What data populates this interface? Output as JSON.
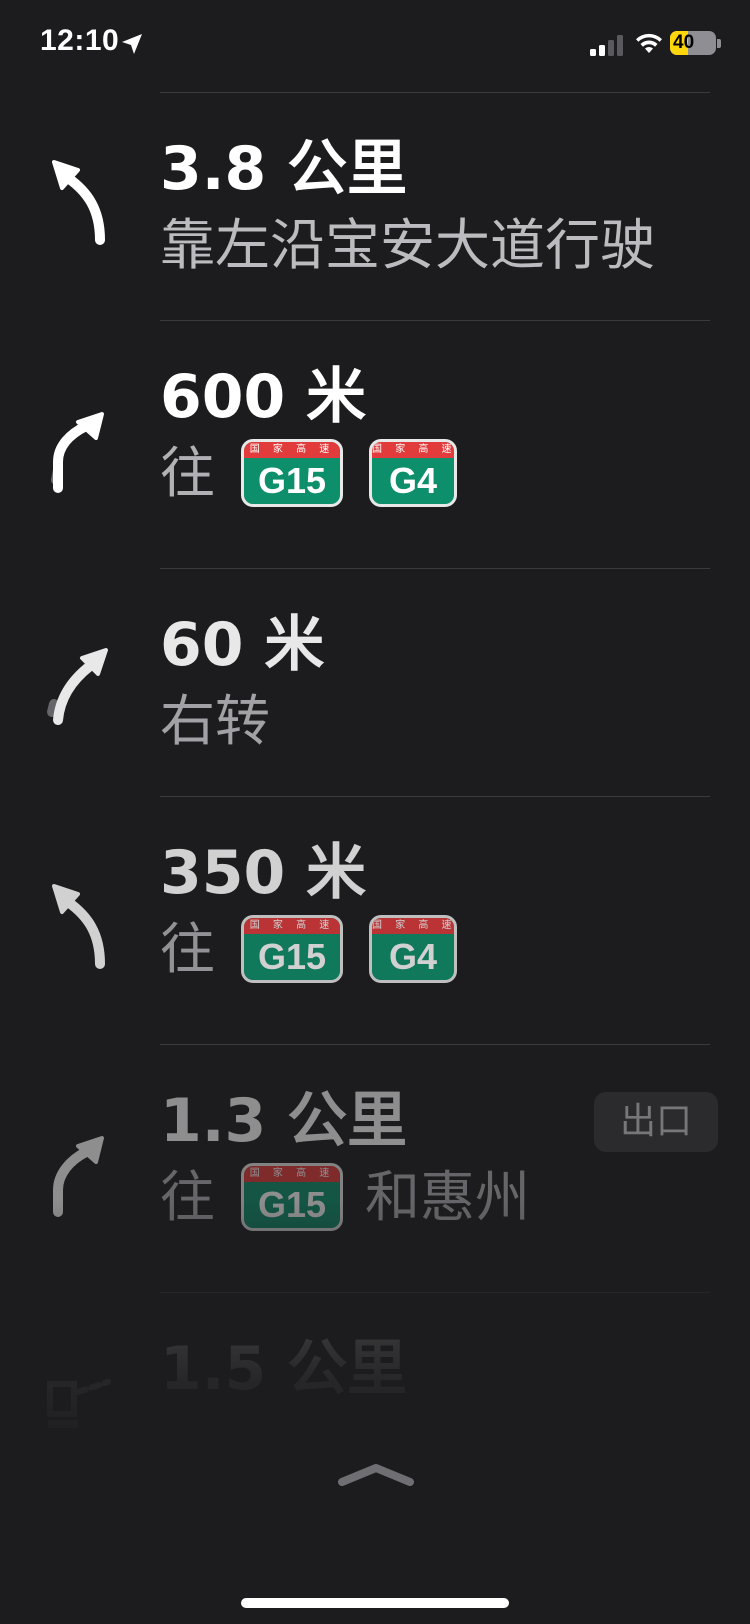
{
  "status_bar": {
    "time": "12:10",
    "battery_level": "40",
    "battery_fraction": 0.4,
    "signal_bars_active": 2,
    "signal_bars_total": 4,
    "icons": [
      "location-arrow-icon",
      "cellular-signal-icon",
      "wifi-icon",
      "battery-charging-icon"
    ]
  },
  "shield_header": "国 家 高 速",
  "steps": [
    {
      "distance": "3.8 公里",
      "instruction": "靠左沿宝安大道行驶",
      "icon": "keep-left-arrow-icon",
      "opacity": 1.0
    },
    {
      "distance": "600 米",
      "instruction_prefix": "往",
      "shields": [
        "G15",
        "G4"
      ],
      "icon": "bear-right-arrow-icon",
      "opacity": 1.0
    },
    {
      "distance": "60 米",
      "instruction": "右转",
      "icon": "turn-right-arrow-icon",
      "opacity": 0.9
    },
    {
      "distance": "350 米",
      "instruction_prefix": "往",
      "shields": [
        "G15",
        "G4"
      ],
      "icon": "keep-left-arrow-icon",
      "opacity": 0.8
    },
    {
      "distance": "1.3 公里",
      "instruction_prefix": "往",
      "shields": [
        "G15"
      ],
      "instruction_suffix": "和惠州",
      "exit_label": "出口",
      "icon": "bear-right-arrow-icon",
      "opacity": 0.5
    },
    {
      "distance": "1.5 公里",
      "icon": "toll-gate-icon",
      "opacity": 0.3
    }
  ],
  "colors": {
    "background": "#1c1c1e",
    "divider": "#3a3a3c",
    "shield_green": "#0e8f6b",
    "shield_red": "#e23b3b",
    "battery_yellow": "#ffd60a"
  }
}
